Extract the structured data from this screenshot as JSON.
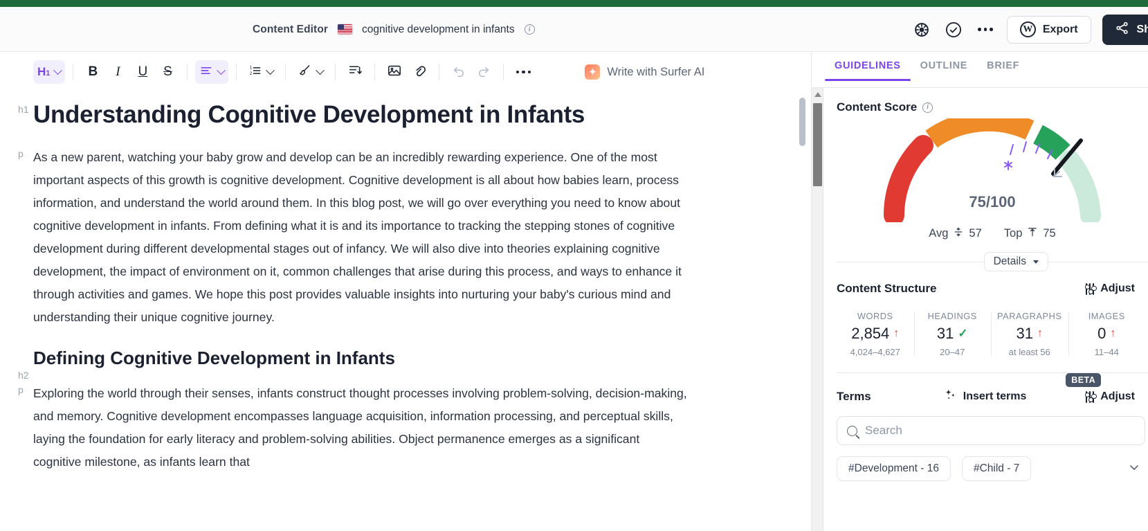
{
  "header": {
    "app_label": "Content Editor",
    "flag_icon": "us-flag-icon",
    "keyword": "cognitive development in infants",
    "info_icon": "info-icon",
    "settings_icon": "gear-icon",
    "check_icon": "check-circle-icon",
    "more_icon": "more-horizontal-icon",
    "export_label": "Export",
    "wordpress_icon": "wordpress-icon",
    "share_label": "Sh",
    "share_icon": "share-icon"
  },
  "toolbar": {
    "heading_label": "H",
    "heading_sub": "1",
    "bold_label": "B",
    "italic_label": "I",
    "underline_label": "U",
    "strike_label": "S",
    "align_icon": "align-left-icon",
    "list_icon": "numbered-list-icon",
    "brush_icon": "brush-icon",
    "indent_icon": "indent-icon",
    "image_icon": "image-icon",
    "link_icon": "link-icon",
    "undo_icon": "undo-icon",
    "redo_icon": "redo-icon",
    "more_icon": "more-horizontal-icon",
    "ai_label": "Write with Surfer AI",
    "ai_icon": "sparkle-icon"
  },
  "document": {
    "blocks": [
      {
        "tag": "h1",
        "text": "Understanding Cognitive Development in Infants"
      },
      {
        "tag": "p",
        "text": "As a new parent, watching your baby grow and develop can be an incredibly rewarding experience. One of the most important aspects of this growth is cognitive development. Cognitive development is all about how babies learn, process information, and understand the world around them. In this blog post, we will go over everything you need to know about cognitive development in infants. From defining what it is and its importance to tracking the stepping stones of cognitive development during different developmental stages out of infancy. We will also dive into theories explaining cognitive development, the impact of environment on it, common challenges that arise during this process, and ways to enhance it through activities and games. We hope this post provides valuable insights into nurturing your baby's curious mind and understanding their unique cognitive journey."
      },
      {
        "tag": "h2",
        "text": "Defining Cognitive Development in Infants"
      },
      {
        "tag": "p",
        "text": "Exploring the world through their senses, infants construct thought processes involving problem-solving, decision-making, and memory. Cognitive development encompasses language acquisition, information processing, and perceptual skills, laying the foundation for early literacy and problem-solving abilities. Object permanence emerges as a significant cognitive milestone, as infants learn that"
      }
    ]
  },
  "sidebar": {
    "tabs": [
      {
        "label": "GUIDELINES",
        "active": true
      },
      {
        "label": "OUTLINE",
        "active": false
      },
      {
        "label": "BRIEF",
        "active": false
      }
    ],
    "content_score": {
      "title": "Content Score",
      "info_icon": "info-icon",
      "value": "75",
      "max": "/100",
      "avg_label": "Avg",
      "avg_value": "57",
      "avg_icon": "average-icon",
      "top_label": "Top",
      "top_value": "75",
      "top_icon": "top-arrow-icon",
      "details_label": "Details",
      "details_chevron": "chevron-down-icon"
    },
    "content_structure": {
      "title": "Content Structure",
      "adjust_label": "Adjust",
      "adjust_icon": "sliders-icon",
      "stats": [
        {
          "label": "WORDS",
          "value": "2,854",
          "status": "up",
          "sub": "4,024–4,627"
        },
        {
          "label": "HEADINGS",
          "value": "31",
          "status": "check",
          "sub": "20–47"
        },
        {
          "label": "PARAGRAPHS",
          "value": "31",
          "status": "up",
          "sub": "at least 56"
        },
        {
          "label": "IMAGES",
          "value": "0",
          "status": "up",
          "sub": "11–44"
        }
      ]
    },
    "terms": {
      "title": "Terms",
      "insert_label": "Insert terms",
      "insert_icon": "sparkle-icon",
      "beta_label": "BETA",
      "adjust_label": "Adjust",
      "adjust_icon": "sliders-icon",
      "search_placeholder": "Search",
      "search_value": "",
      "search_icon": "search-icon",
      "chips": [
        {
          "label": "#Development - 16"
        },
        {
          "label": "#Child - 7"
        }
      ],
      "chip_chevron": "chevron-down-icon"
    }
  },
  "colors": {
    "accent_purple": "#7b45e8",
    "top_green_bar": "#1f6b3b",
    "gauge_red": "#e03a32",
    "gauge_orange": "#ef8c28",
    "gauge_green": "#27a25b",
    "gauge_light_green": "#cceadb",
    "status_up_red": "#e8453c",
    "status_check_green": "#23a455",
    "share_dark": "#1f2937"
  }
}
